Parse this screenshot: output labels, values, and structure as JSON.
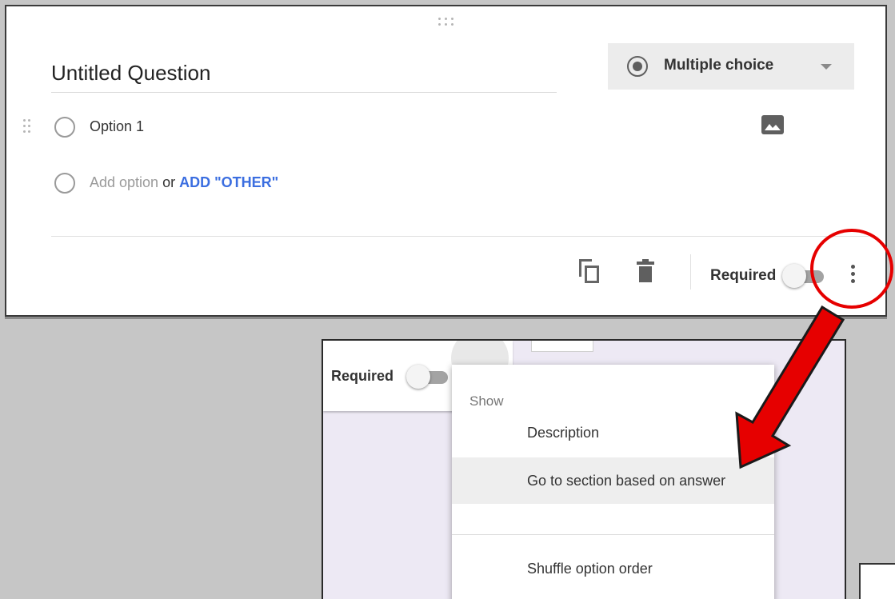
{
  "question": {
    "title": "Untitled Question",
    "type_label": "Multiple choice",
    "options": [
      {
        "label": "Option 1"
      }
    ],
    "add_option": "Add option",
    "or_text": "or",
    "add_other": "ADD \"OTHER\"",
    "required_label": "Required",
    "required_on": false
  },
  "inset": {
    "required_label": "Required",
    "menu": {
      "header": "Show",
      "items": [
        {
          "label": "Description"
        },
        {
          "label": "Go to section based on answer"
        },
        {
          "label": "Shuffle option order"
        }
      ]
    }
  },
  "colors": {
    "background": "#c6c6c6",
    "link": "#3b6ee0",
    "annotation_red": "#e60000",
    "inset_background": "#ede9f4"
  },
  "icons": [
    "drag-handle-icon",
    "radio-selected-icon",
    "dropdown-caret-icon",
    "image-icon",
    "duplicate-icon",
    "delete-icon",
    "more-vert-icon"
  ]
}
